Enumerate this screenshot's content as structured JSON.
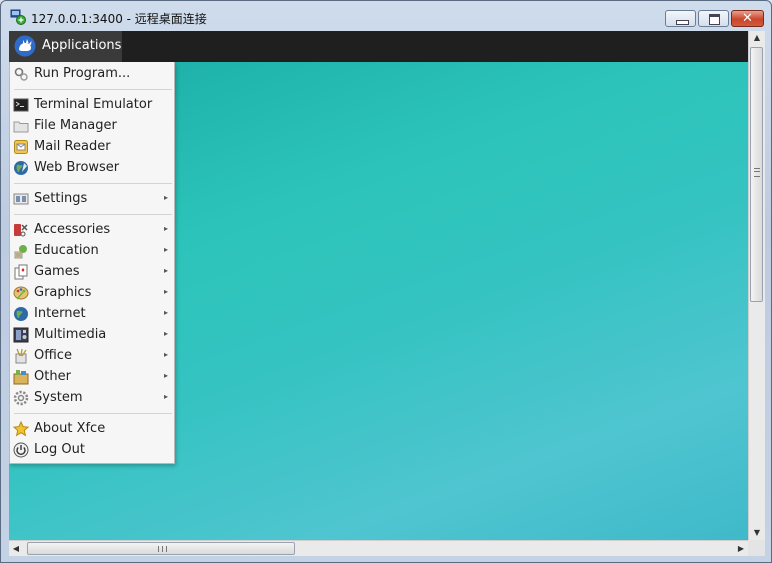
{
  "window": {
    "title": "127.0.0.1:3400 - 远程桌面连接",
    "icon": "remote-desktop-icon",
    "close_glyph": "✕"
  },
  "panel": {
    "applications_label": "Applications",
    "logo_icon": "xfce-mouse-logo"
  },
  "menu": {
    "groups": [
      [
        {
          "label": "Run Program...",
          "icon": "gears-icon",
          "submenu": false
        }
      ],
      [
        {
          "label": "Terminal Emulator",
          "icon": "terminal-icon",
          "submenu": false
        },
        {
          "label": "File Manager",
          "icon": "folder-icon",
          "submenu": false
        },
        {
          "label": "Mail Reader",
          "icon": "mail-icon",
          "submenu": false
        },
        {
          "label": "Web Browser",
          "icon": "globe-icon",
          "submenu": false
        }
      ],
      [
        {
          "label": "Settings",
          "icon": "settings-icon",
          "submenu": true
        }
      ],
      [
        {
          "label": "Accessories",
          "icon": "accessories-icon",
          "submenu": true
        },
        {
          "label": "Education",
          "icon": "education-icon",
          "submenu": true
        },
        {
          "label": "Games",
          "icon": "games-icon",
          "submenu": true
        },
        {
          "label": "Graphics",
          "icon": "graphics-icon",
          "submenu": true
        },
        {
          "label": "Internet",
          "icon": "internet-icon",
          "submenu": true
        },
        {
          "label": "Multimedia",
          "icon": "multimedia-icon",
          "submenu": true
        },
        {
          "label": "Office",
          "icon": "office-icon",
          "submenu": true
        },
        {
          "label": "Other",
          "icon": "other-icon",
          "submenu": true
        },
        {
          "label": "System",
          "icon": "system-icon",
          "submenu": true
        }
      ],
      [
        {
          "label": "About Xfce",
          "icon": "star-icon",
          "submenu": false
        },
        {
          "label": "Log Out",
          "icon": "power-icon",
          "submenu": false
        }
      ]
    ],
    "submenu_arrow": "▸"
  },
  "scrollbars": {
    "up_arrow": "▲",
    "down_arrow": "▼",
    "left_arrow": "◀",
    "right_arrow": "▶"
  },
  "colors": {
    "desktop_teal": "#2cc4ba",
    "panel_bg": "#1f1f1f",
    "menu_bg": "#f6f6f6"
  }
}
